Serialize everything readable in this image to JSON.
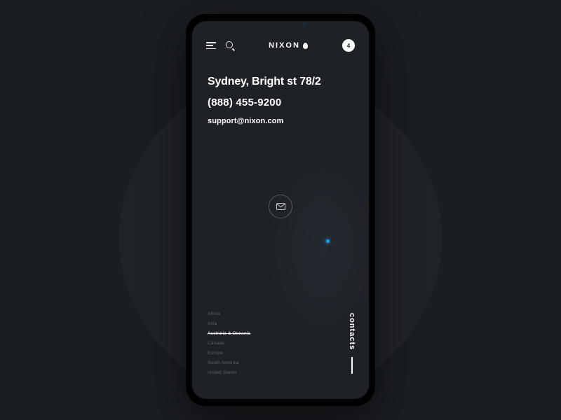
{
  "header": {
    "brand": "NIXON",
    "badge_count": "4"
  },
  "contact": {
    "address": "Sydney, Bright st 78/2",
    "phone": "(888) 455-9200",
    "email": "support@nixon.com"
  },
  "regions": [
    {
      "label": "Africa",
      "active": false
    },
    {
      "label": "Asia",
      "active": false
    },
    {
      "label": "Australia & Oceania",
      "active": true
    },
    {
      "label": "Canada",
      "active": false
    },
    {
      "label": "Europe",
      "active": false
    },
    {
      "label": "South America",
      "active": false
    },
    {
      "label": "United States",
      "active": false
    }
  ],
  "page_label": "contacts",
  "colors": {
    "bg": "#1a1d21",
    "screen": "#1e2126",
    "accent": "#1d9bf0"
  }
}
